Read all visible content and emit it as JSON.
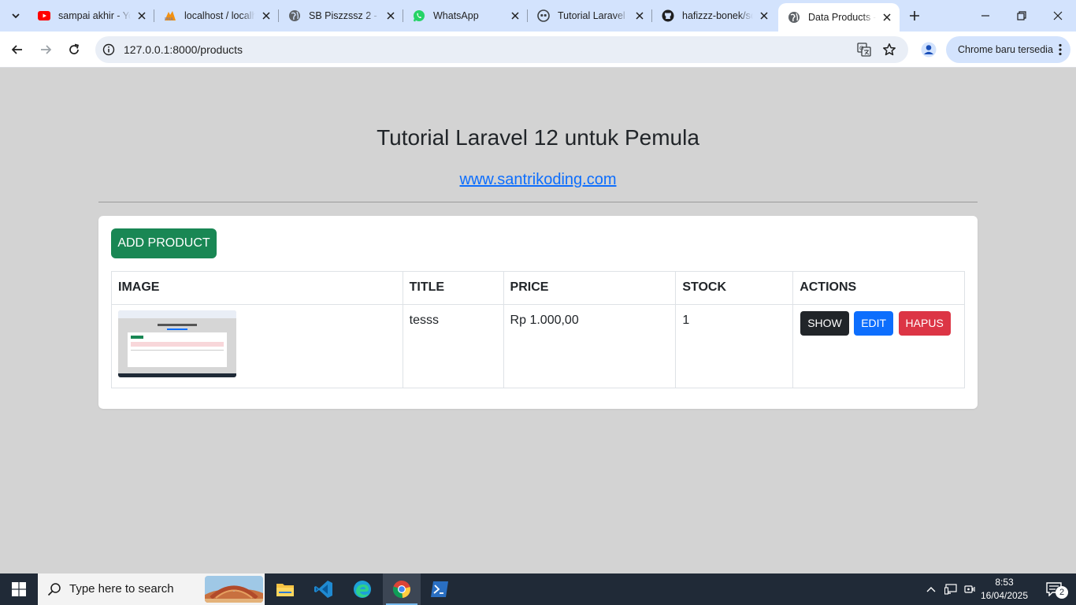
{
  "browser": {
    "tabs": [
      {
        "label": "sampai akhir - Yo",
        "icon": "youtube-icon"
      },
      {
        "label": "localhost / localh",
        "icon": "phpmyadmin-icon"
      },
      {
        "label": "SB Piszzssz 2 - B",
        "icon": "globe-icon"
      },
      {
        "label": "WhatsApp",
        "icon": "whatsapp-icon"
      },
      {
        "label": "Tutorial Laravel",
        "icon": "copilot-icon"
      },
      {
        "label": "hafizzz-bonek/sc",
        "icon": "github-icon"
      },
      {
        "label": "Data Products -",
        "icon": "globe-icon",
        "active": true
      }
    ],
    "url": "127.0.0.1:8000/products",
    "update_label": "Chrome baru tersedia"
  },
  "page": {
    "title": "Tutorial Laravel 12 untuk Pemula",
    "link": "www.santrikoding.com",
    "add_button": "ADD PRODUCT",
    "table": {
      "headers": [
        "IMAGE",
        "TITLE",
        "PRICE",
        "STOCK",
        "ACTIONS"
      ],
      "rows": [
        {
          "title": "tesss",
          "price": "Rp 1.000,00",
          "stock": "1"
        }
      ],
      "actions": {
        "show": "SHOW",
        "edit": "EDIT",
        "delete": "HAPUS"
      }
    }
  },
  "taskbar": {
    "search_placeholder": "Type here to search",
    "time": "8:53",
    "date": "16/04/2025",
    "notification_count": "2"
  },
  "colors": {
    "page_bg": "#d3d3d3",
    "add_button": "#198754",
    "show_button": "#212529",
    "edit_button": "#0d6efd",
    "delete_button": "#dc3545",
    "link": "#0d6efd"
  }
}
